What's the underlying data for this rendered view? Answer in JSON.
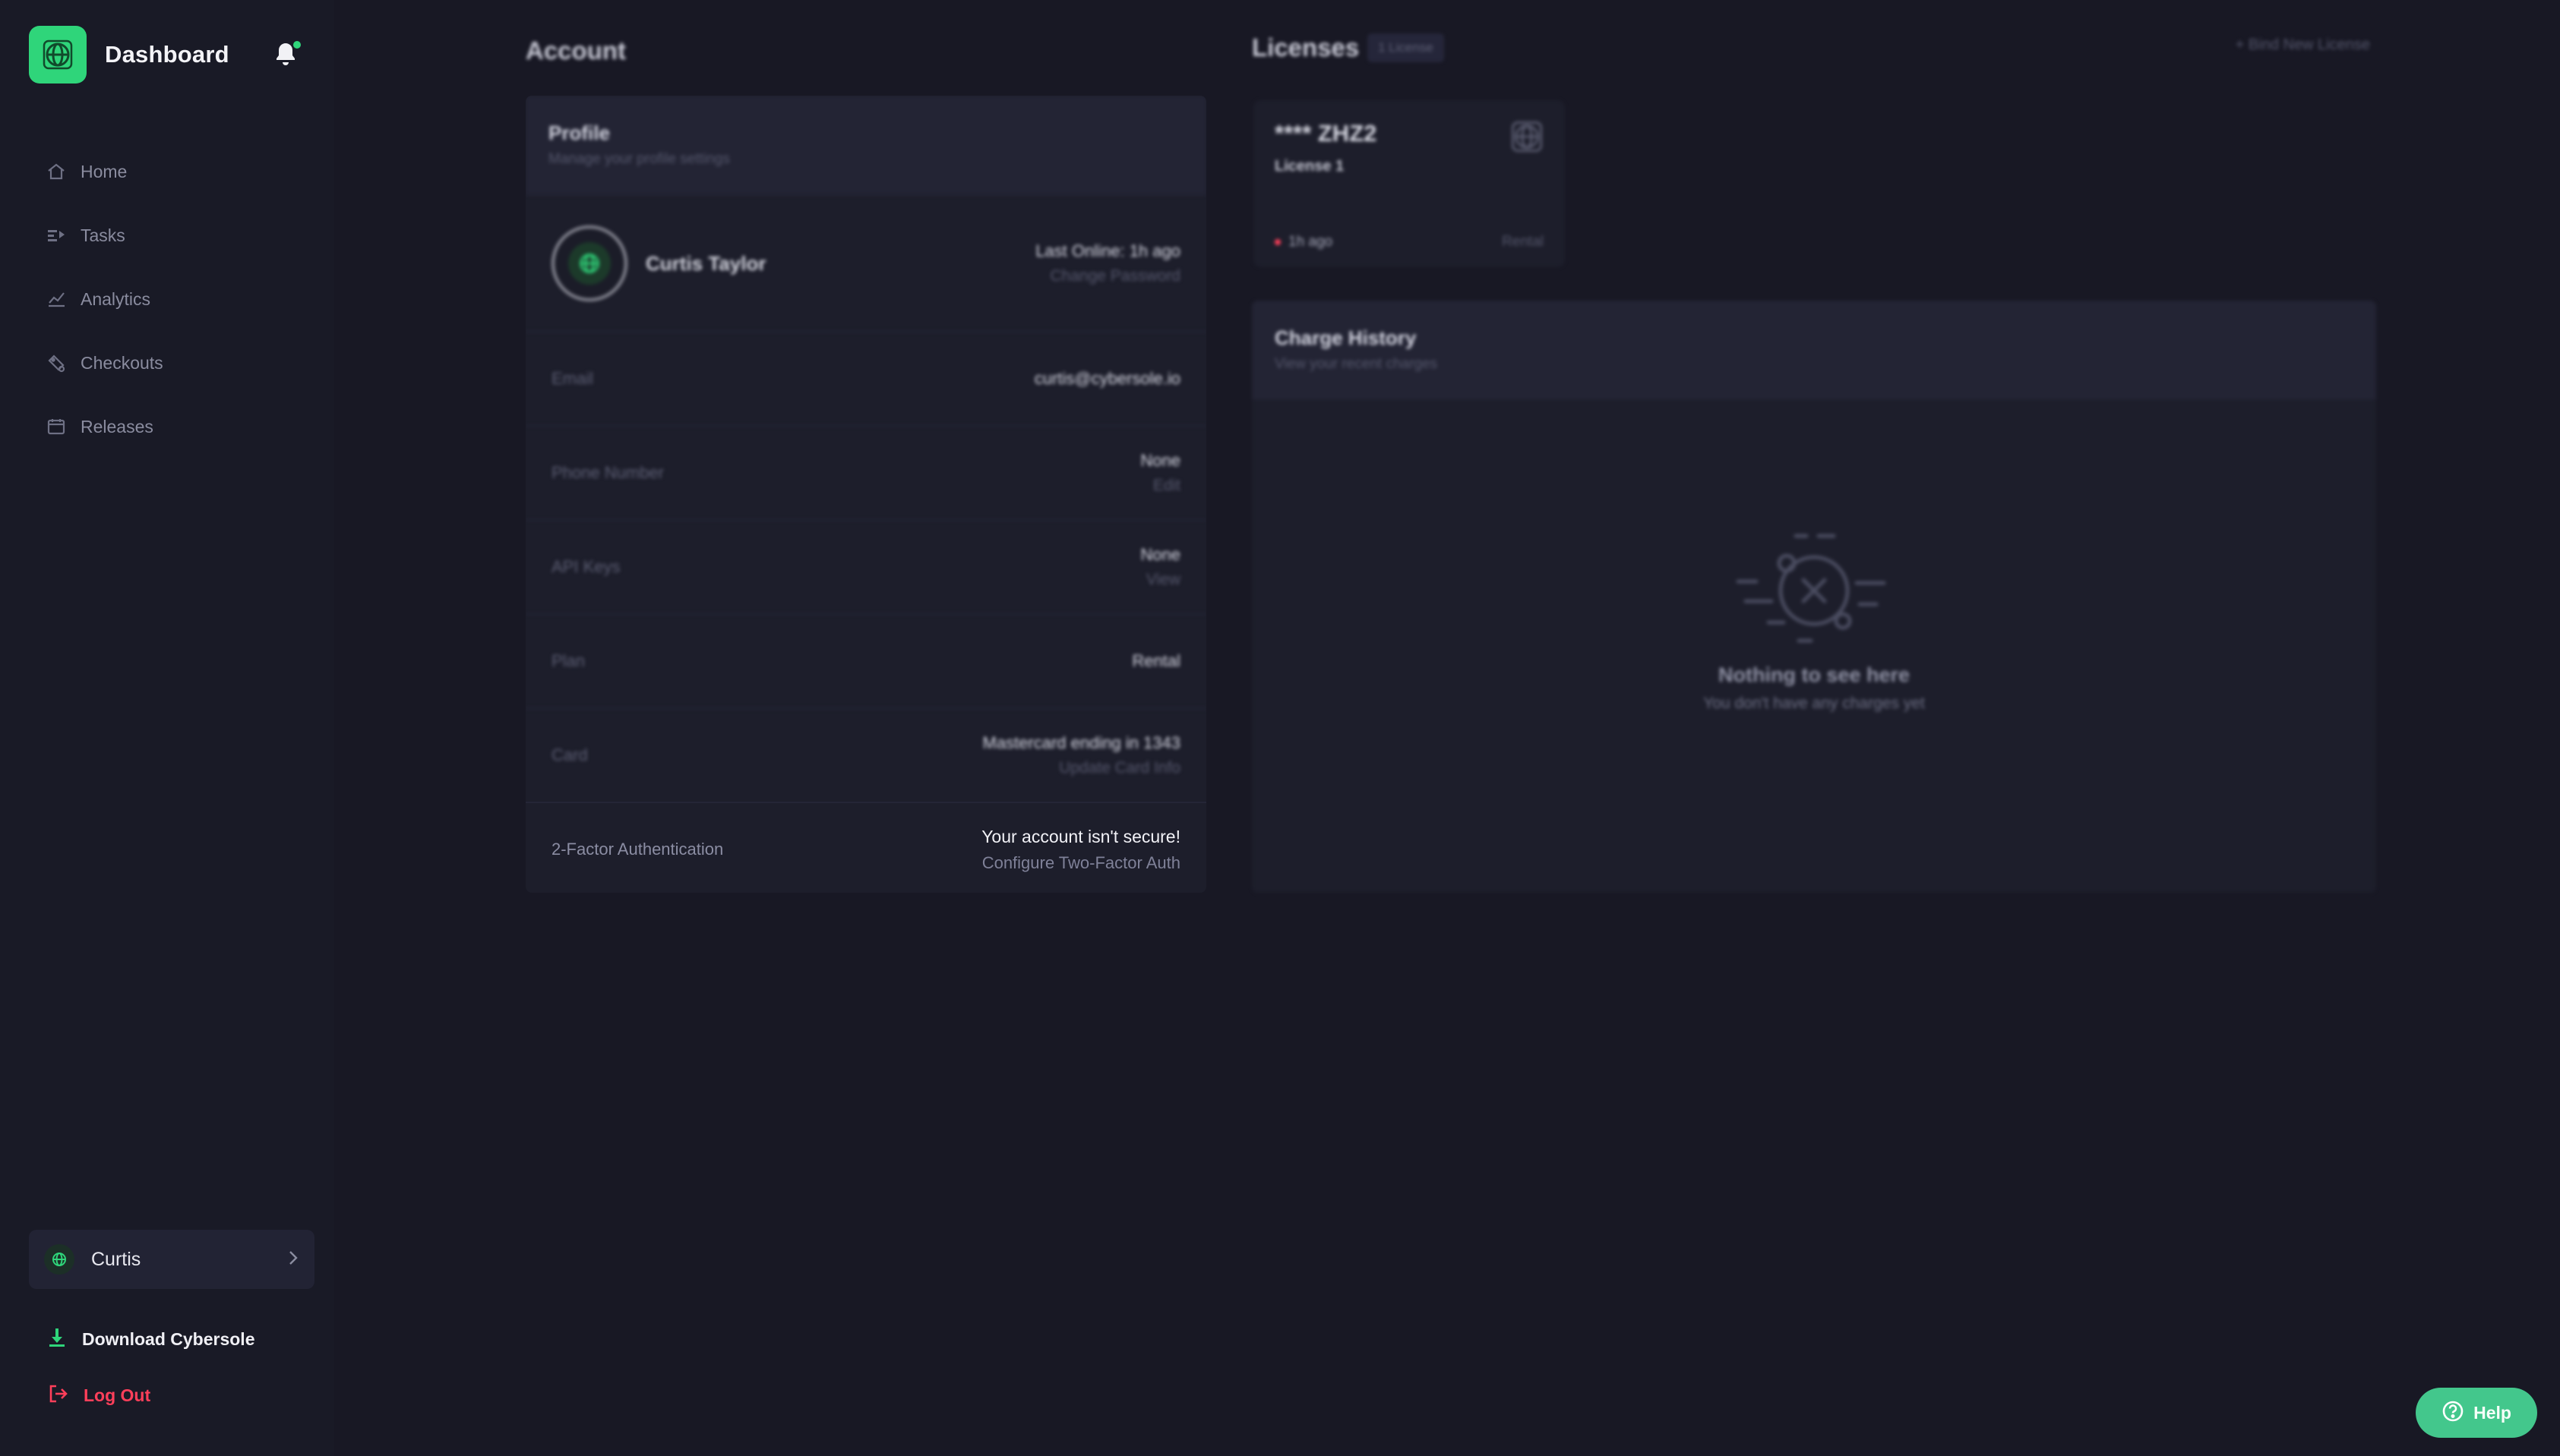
{
  "sidebar": {
    "title": "Dashboard",
    "icons": {
      "logo": "globe-logo-icon",
      "bell": "bell-icon"
    },
    "accent_color": "#2fd57a",
    "nav": [
      {
        "label": "Home",
        "icon": "home-icon"
      },
      {
        "label": "Tasks",
        "icon": "tasks-icon"
      },
      {
        "label": "Analytics",
        "icon": "analytics-icon"
      },
      {
        "label": "Checkouts",
        "icon": "checkouts-icon"
      },
      {
        "label": "Releases",
        "icon": "releases-icon"
      }
    ],
    "user": {
      "name": "Curtis"
    },
    "download_label": "Download Cybersole",
    "logout_label": "Log Out",
    "logout_color": "#ff3f5a"
  },
  "account": {
    "title": "Account",
    "profile": {
      "header_title": "Profile",
      "header_subtitle": "Manage your profile settings",
      "name": "Curtis Taylor",
      "last_online": "Last Online: 1h ago",
      "change_password": "Change Password",
      "rows": [
        {
          "key": "Email",
          "value": "curtis@cybersole.io",
          "sub": ""
        },
        {
          "key": "Phone Number",
          "value": "None",
          "sub": "Edit"
        },
        {
          "key": "API Keys",
          "value": "None",
          "sub": "View"
        },
        {
          "key": "Plan",
          "value": "Rental",
          "sub": ""
        },
        {
          "key": "Card",
          "value": "Mastercard ending in 1343",
          "sub": "Update Card Info"
        }
      ],
      "two_factor": {
        "key": "2-Factor Authentication",
        "value": "Your account isn't secure!",
        "action": "Configure Two-Factor Auth"
      }
    }
  },
  "licenses": {
    "title": "Licenses",
    "count_badge": "1 License",
    "bind_new": "+ Bind New License",
    "items": [
      {
        "key": "**** ZHZ2",
        "name": "License 1",
        "time": "1h ago",
        "type": "Rental"
      }
    ]
  },
  "charge_history": {
    "header_title": "Charge History",
    "header_subtitle": "View your recent charges",
    "empty_title": "Nothing to see here",
    "empty_subtitle": "You don't have any charges yet"
  },
  "help": {
    "label": "Help",
    "icon": "help-icon"
  }
}
